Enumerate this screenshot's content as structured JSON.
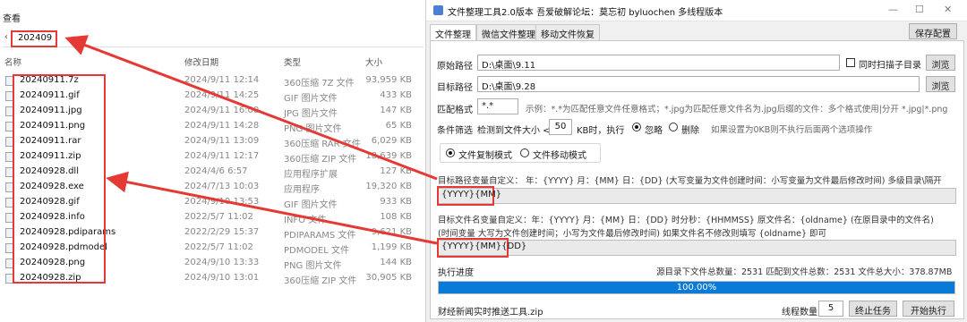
{
  "explorer": {
    "menu_view": "查看",
    "address_chevron": "‹",
    "address_value": "202409",
    "columns": {
      "name": "名称",
      "date": "修改日期",
      "type": "类型",
      "size": "大小"
    },
    "files": [
      {
        "name": "20240911.7z",
        "date": "2024/9/11 12:14",
        "type": "360压缩 7Z 文件",
        "size": "93,959 KB"
      },
      {
        "name": "20240911.gif",
        "date": "2024/9/11 14:25",
        "type": "GIF 图片文件",
        "size": "433 KB"
      },
      {
        "name": "20240911.jpg",
        "date": "2024/9/11 16:00",
        "type": "JPG 图片文件",
        "size": "147 KB"
      },
      {
        "name": "20240911.png",
        "date": "2024/9/11 14:28",
        "type": "PNG 图片文件",
        "size": "65 KB"
      },
      {
        "name": "20240911.rar",
        "date": "2024/9/11 13:09",
        "type": "360压缩 RAR 文件",
        "size": "6,029 KB"
      },
      {
        "name": "20240911.zip",
        "date": "2024/9/11 12:17",
        "type": "360压缩 ZIP 文件",
        "size": "18,639 KB"
      },
      {
        "name": "20240928.dll",
        "date": "2024/4/6 6:57",
        "type": "应用程序扩展",
        "size": "127 KB"
      },
      {
        "name": "20240928.exe",
        "date": "2024/7/13 10:03",
        "type": "应用程序",
        "size": "19,320 KB"
      },
      {
        "name": "20240928.gif",
        "date": "2024/9/10 13:53",
        "type": "GIF 图片文件",
        "size": "933 KB"
      },
      {
        "name": "20240928.info",
        "date": "2022/5/7 11:02",
        "type": "INFO 文件",
        "size": "108 KB"
      },
      {
        "name": "20240928.pdiparams",
        "date": "2022/2/29 15:37",
        "type": "PDIPARAMS 文件",
        "size": "9,621 KB"
      },
      {
        "name": "20240928.pdmodel",
        "date": "2022/5/7 11:02",
        "type": "PDMODEL 文件",
        "size": "1,199 KB"
      },
      {
        "name": "20240928.png",
        "date": "2024/9/10 13:33",
        "type": "PNG 图片文件",
        "size": "144 KB"
      },
      {
        "name": "20240928.zip",
        "date": "2024/9/10 13:01",
        "type": "360压缩 ZIP 文件",
        "size": "30,905 KB"
      }
    ]
  },
  "tool": {
    "title": "文件整理工具2.0版本   吾爱破解论坛：莫忘初   byluochen   多线程版本",
    "win_min": "—",
    "win_max": "☐",
    "win_close": "✕",
    "tabs": [
      "文件整理",
      "微信文件整理",
      "移动文件恢复"
    ],
    "save_config": "保存配置",
    "source_label": "原始路径",
    "source_value": "D:\\桌面\\9.11",
    "scan_subdirs": "同时扫描子目录",
    "browse": "浏览",
    "target_label": "目标路径",
    "target_value": "D:\\桌面\\9.28",
    "pattern_label": "匹配格式",
    "pattern_value": "*.*",
    "pattern_hint": "示例：*.*为匹配任意文件任意格式；*.jpg为匹配任意文件名为.jpg后缀的文件：多个格式使用|分开 *.jpg|*.png",
    "filter_label": "条件筛选",
    "filter_prefix": "检测到文件大小 <",
    "filter_size": "50",
    "filter_suffix": "KB时，执行",
    "opt_ignore": "忽略",
    "opt_delete": "删除",
    "filter_hint": "如果设置为0KB则不执行后面两个选项操作",
    "mode_copy": "文件复制模式",
    "mode_move": "文件移动模式",
    "dir_var_label": "目标路径变量自定义：  年：{YYYY}  月：{MM}  日：{DD}     (大写变量为文件创建时间：小写变量为文件最后修改时间)     多级目录\\隔开",
    "dir_var_value": "{YYYY}{MM}",
    "name_var_label": "目标文件名变量自定义：年：{YYYY}  月：{MM}  日：{DD}  时分秒：{HHMMSS}      原文件名：{oldname}  (在原目录中的文件名)",
    "name_var_label2": "(时间变量 大写为文件创建时间；小写为文件最后修改时间)    如果文件名不修改则填写 {oldname} 即可",
    "name_var_value": "{YYYY}{MM}{DD}",
    "progress_label": "执行进度",
    "stats": "源目录下文件总数量：2531   匹配到文件总数：2531   文件总大小：378.87MB",
    "progress_text": "100.00%",
    "progress_value": 1.0,
    "status_file": "财经新闻实时推送工具.zip",
    "threads_label": "线程数量",
    "threads_value": "5",
    "stop_btn": "终止任务",
    "start_btn": "开始执行"
  },
  "colors": {
    "highlight": "#e53935",
    "progress": "#0a7ad8"
  }
}
